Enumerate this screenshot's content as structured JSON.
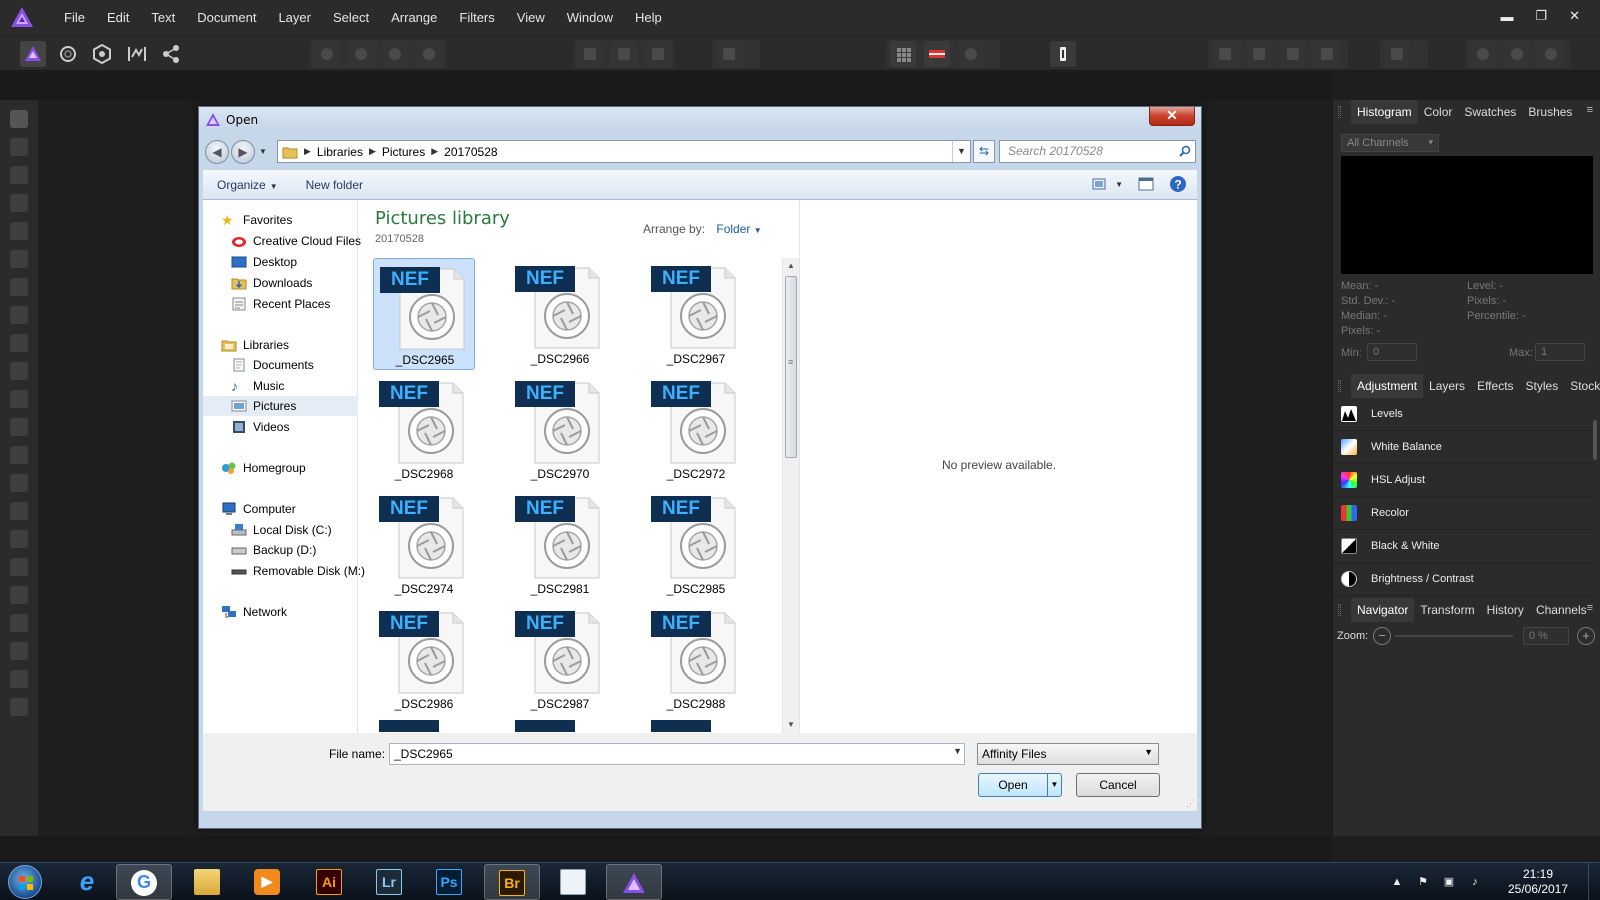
{
  "menubar": {
    "items": [
      "File",
      "Edit",
      "Text",
      "Document",
      "Layer",
      "Select",
      "Arrange",
      "Filters",
      "View",
      "Window",
      "Help"
    ],
    "controls": {
      "minimize": "▬",
      "restore": "❐",
      "close": "✕"
    }
  },
  "histogram_panel": {
    "tabs": [
      "Histogram",
      "Color",
      "Swatches",
      "Brushes"
    ],
    "channel_select": "All Channels",
    "stats": {
      "mean": "Mean: -",
      "std_dev": "Std. Dev.: -",
      "median": "Median: -",
      "pixels_left": "Pixels: -",
      "level": "Level: -",
      "pixels_right": "Pixels: -",
      "percentile": "Percentile: -"
    },
    "min_label": "Min:",
    "min_value": "0",
    "max_label": "Max:",
    "max_value": "1"
  },
  "adjustment_panel": {
    "tabs": [
      "Adjustment",
      "Layers",
      "Effects",
      "Styles",
      "Stock"
    ],
    "items": [
      {
        "label": "Levels"
      },
      {
        "label": "White Balance"
      },
      {
        "label": "HSL Adjust"
      },
      {
        "label": "Recolor"
      },
      {
        "label": "Black & White"
      },
      {
        "label": "Brightness / Contrast"
      }
    ]
  },
  "navigator_panel": {
    "tabs": [
      "Navigator",
      "Transform",
      "History",
      "Channels"
    ],
    "zoom_label": "Zoom:",
    "zoom_value": "0 %"
  },
  "dialog": {
    "title": "Open",
    "close_label": "✕",
    "breadcrumb": [
      "Libraries",
      "Pictures",
      "20170528"
    ],
    "search_placeholder": "Search 20170528",
    "toolbar": {
      "organize": "Organize",
      "new_folder": "New folder"
    },
    "nav": {
      "favorites": "Favorites",
      "favorite_items": [
        "Creative Cloud Files",
        "Desktop",
        "Downloads",
        "Recent Places"
      ],
      "libraries": "Libraries",
      "library_items": [
        "Documents",
        "Music",
        "Pictures",
        "Videos"
      ],
      "homegroup": "Homegroup",
      "computer": "Computer",
      "computer_items": [
        "Local Disk (C:)",
        "Backup (D:)",
        "Removable Disk (M:)"
      ],
      "network": "Network"
    },
    "library_title": "Pictures library",
    "library_subtitle": "20170528",
    "arrange_label": "Arrange by:",
    "arrange_value": "Folder",
    "file_badge": "NEF",
    "files": [
      "_DSC2965",
      "_DSC2966",
      "_DSC2967",
      "_DSC2968",
      "_DSC2970",
      "_DSC2972",
      "_DSC2974",
      "_DSC2981",
      "_DSC2985",
      "_DSC2986",
      "_DSC2987",
      "_DSC2988"
    ],
    "preview_text": "No preview available.",
    "filename_label": "File name:",
    "filename_value": "_DSC2965",
    "filetype_value": "Affinity Files",
    "open_label": "Open",
    "cancel_label": "Cancel"
  },
  "taskbar": {
    "apps": [
      {
        "name": "internet-explorer",
        "label": "e"
      },
      {
        "name": "google-chrome",
        "label": "G"
      },
      {
        "name": "file-explorer",
        "label": ""
      },
      {
        "name": "media-player",
        "label": "▶"
      },
      {
        "name": "illustrator",
        "label": "Ai"
      },
      {
        "name": "lightroom",
        "label": "Lr"
      },
      {
        "name": "photoshop",
        "label": "Ps"
      },
      {
        "name": "bridge",
        "label": "Br"
      },
      {
        "name": "notepad",
        "label": ""
      },
      {
        "name": "affinity-photo",
        "label": ""
      }
    ],
    "time": "21:19",
    "date": "25/06/2017"
  },
  "colors": {
    "affinity_purple": "#7b3fd6",
    "nef_badge": "#0f2f52",
    "nef_text": "#3ab0ff",
    "library_green": "#2a7b3e"
  }
}
